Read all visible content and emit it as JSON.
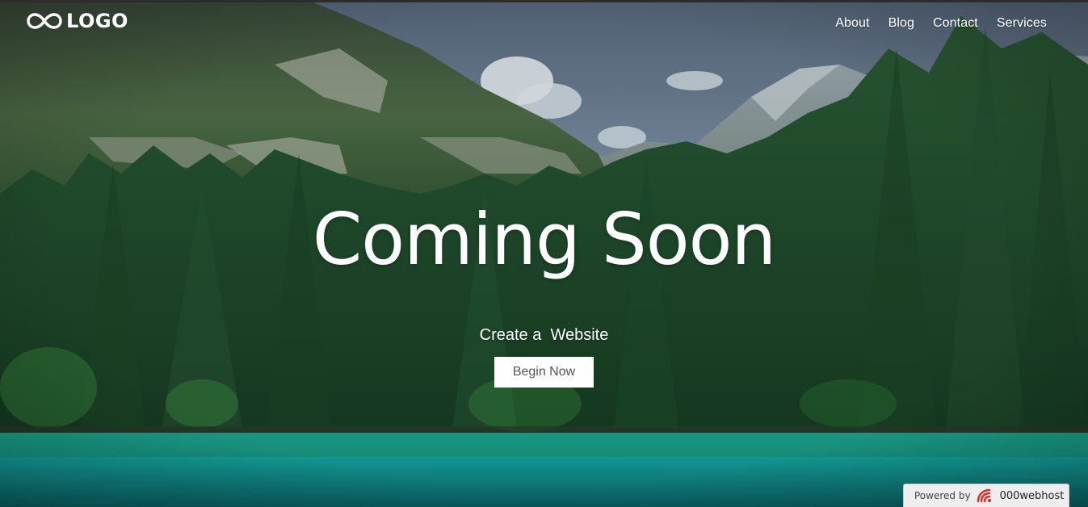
{
  "logo": {
    "icon": "infinity-icon",
    "text": "LOGO"
  },
  "nav": {
    "items": [
      {
        "label": "About"
      },
      {
        "label": "Blog"
      },
      {
        "label": "Contact"
      },
      {
        "label": "Services"
      }
    ]
  },
  "hero": {
    "title": "Coming Soon",
    "subtitle": "Create a  Website",
    "button_label": "Begin Now",
    "background": "mountain-forest-lake-photo"
  },
  "badge": {
    "label": "Powered by",
    "brand": "000webhost",
    "icon": "000webhost-logo-icon"
  },
  "colors": {
    "text": "#ffffff",
    "button_bg": "#ffffff",
    "button_text": "#555555",
    "lake": "#1aa7a1",
    "forest": "#1f4a2c",
    "sky": "#aebfcf",
    "brand_red": "#e02424"
  }
}
